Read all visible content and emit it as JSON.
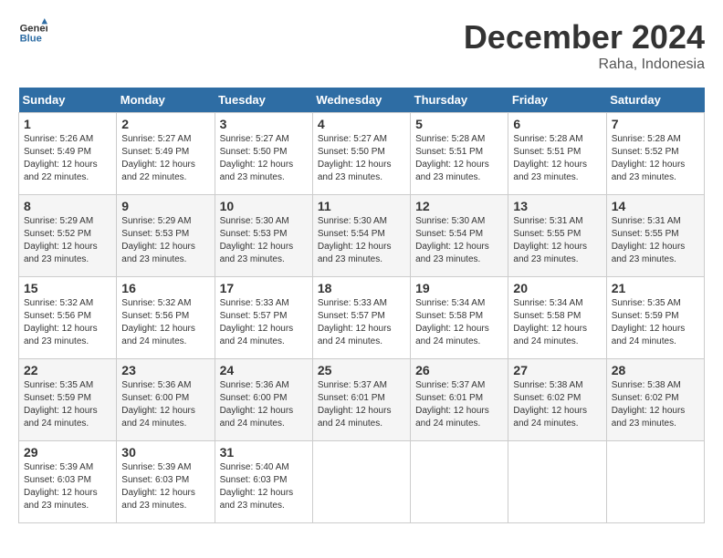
{
  "logo": {
    "line1": "General",
    "line2": "Blue"
  },
  "title": "December 2024",
  "location": "Raha, Indonesia",
  "days_of_week": [
    "Sunday",
    "Monday",
    "Tuesday",
    "Wednesday",
    "Thursday",
    "Friday",
    "Saturday"
  ],
  "weeks": [
    [
      {
        "day": "1",
        "sunrise": "5:26 AM",
        "sunset": "5:49 PM",
        "daylight": "12 hours and 22 minutes."
      },
      {
        "day": "2",
        "sunrise": "5:27 AM",
        "sunset": "5:49 PM",
        "daylight": "12 hours and 22 minutes."
      },
      {
        "day": "3",
        "sunrise": "5:27 AM",
        "sunset": "5:50 PM",
        "daylight": "12 hours and 23 minutes."
      },
      {
        "day": "4",
        "sunrise": "5:27 AM",
        "sunset": "5:50 PM",
        "daylight": "12 hours and 23 minutes."
      },
      {
        "day": "5",
        "sunrise": "5:28 AM",
        "sunset": "5:51 PM",
        "daylight": "12 hours and 23 minutes."
      },
      {
        "day": "6",
        "sunrise": "5:28 AM",
        "sunset": "5:51 PM",
        "daylight": "12 hours and 23 minutes."
      },
      {
        "day": "7",
        "sunrise": "5:28 AM",
        "sunset": "5:52 PM",
        "daylight": "12 hours and 23 minutes."
      }
    ],
    [
      {
        "day": "8",
        "sunrise": "5:29 AM",
        "sunset": "5:52 PM",
        "daylight": "12 hours and 23 minutes."
      },
      {
        "day": "9",
        "sunrise": "5:29 AM",
        "sunset": "5:53 PM",
        "daylight": "12 hours and 23 minutes."
      },
      {
        "day": "10",
        "sunrise": "5:30 AM",
        "sunset": "5:53 PM",
        "daylight": "12 hours and 23 minutes."
      },
      {
        "day": "11",
        "sunrise": "5:30 AM",
        "sunset": "5:54 PM",
        "daylight": "12 hours and 23 minutes."
      },
      {
        "day": "12",
        "sunrise": "5:30 AM",
        "sunset": "5:54 PM",
        "daylight": "12 hours and 23 minutes."
      },
      {
        "day": "13",
        "sunrise": "5:31 AM",
        "sunset": "5:55 PM",
        "daylight": "12 hours and 23 minutes."
      },
      {
        "day": "14",
        "sunrise": "5:31 AM",
        "sunset": "5:55 PM",
        "daylight": "12 hours and 23 minutes."
      }
    ],
    [
      {
        "day": "15",
        "sunrise": "5:32 AM",
        "sunset": "5:56 PM",
        "daylight": "12 hours and 23 minutes."
      },
      {
        "day": "16",
        "sunrise": "5:32 AM",
        "sunset": "5:56 PM",
        "daylight": "12 hours and 24 minutes."
      },
      {
        "day": "17",
        "sunrise": "5:33 AM",
        "sunset": "5:57 PM",
        "daylight": "12 hours and 24 minutes."
      },
      {
        "day": "18",
        "sunrise": "5:33 AM",
        "sunset": "5:57 PM",
        "daylight": "12 hours and 24 minutes."
      },
      {
        "day": "19",
        "sunrise": "5:34 AM",
        "sunset": "5:58 PM",
        "daylight": "12 hours and 24 minutes."
      },
      {
        "day": "20",
        "sunrise": "5:34 AM",
        "sunset": "5:58 PM",
        "daylight": "12 hours and 24 minutes."
      },
      {
        "day": "21",
        "sunrise": "5:35 AM",
        "sunset": "5:59 PM",
        "daylight": "12 hours and 24 minutes."
      }
    ],
    [
      {
        "day": "22",
        "sunrise": "5:35 AM",
        "sunset": "5:59 PM",
        "daylight": "12 hours and 24 minutes."
      },
      {
        "day": "23",
        "sunrise": "5:36 AM",
        "sunset": "6:00 PM",
        "daylight": "12 hours and 24 minutes."
      },
      {
        "day": "24",
        "sunrise": "5:36 AM",
        "sunset": "6:00 PM",
        "daylight": "12 hours and 24 minutes."
      },
      {
        "day": "25",
        "sunrise": "5:37 AM",
        "sunset": "6:01 PM",
        "daylight": "12 hours and 24 minutes."
      },
      {
        "day": "26",
        "sunrise": "5:37 AM",
        "sunset": "6:01 PM",
        "daylight": "12 hours and 24 minutes."
      },
      {
        "day": "27",
        "sunrise": "5:38 AM",
        "sunset": "6:02 PM",
        "daylight": "12 hours and 24 minutes."
      },
      {
        "day": "28",
        "sunrise": "5:38 AM",
        "sunset": "6:02 PM",
        "daylight": "12 hours and 23 minutes."
      }
    ],
    [
      {
        "day": "29",
        "sunrise": "5:39 AM",
        "sunset": "6:03 PM",
        "daylight": "12 hours and 23 minutes."
      },
      {
        "day": "30",
        "sunrise": "5:39 AM",
        "sunset": "6:03 PM",
        "daylight": "12 hours and 23 minutes."
      },
      {
        "day": "31",
        "sunrise": "5:40 AM",
        "sunset": "6:03 PM",
        "daylight": "12 hours and 23 minutes."
      },
      null,
      null,
      null,
      null
    ]
  ],
  "labels": {
    "sunrise": "Sunrise:",
    "sunset": "Sunset:",
    "daylight": "Daylight:"
  }
}
